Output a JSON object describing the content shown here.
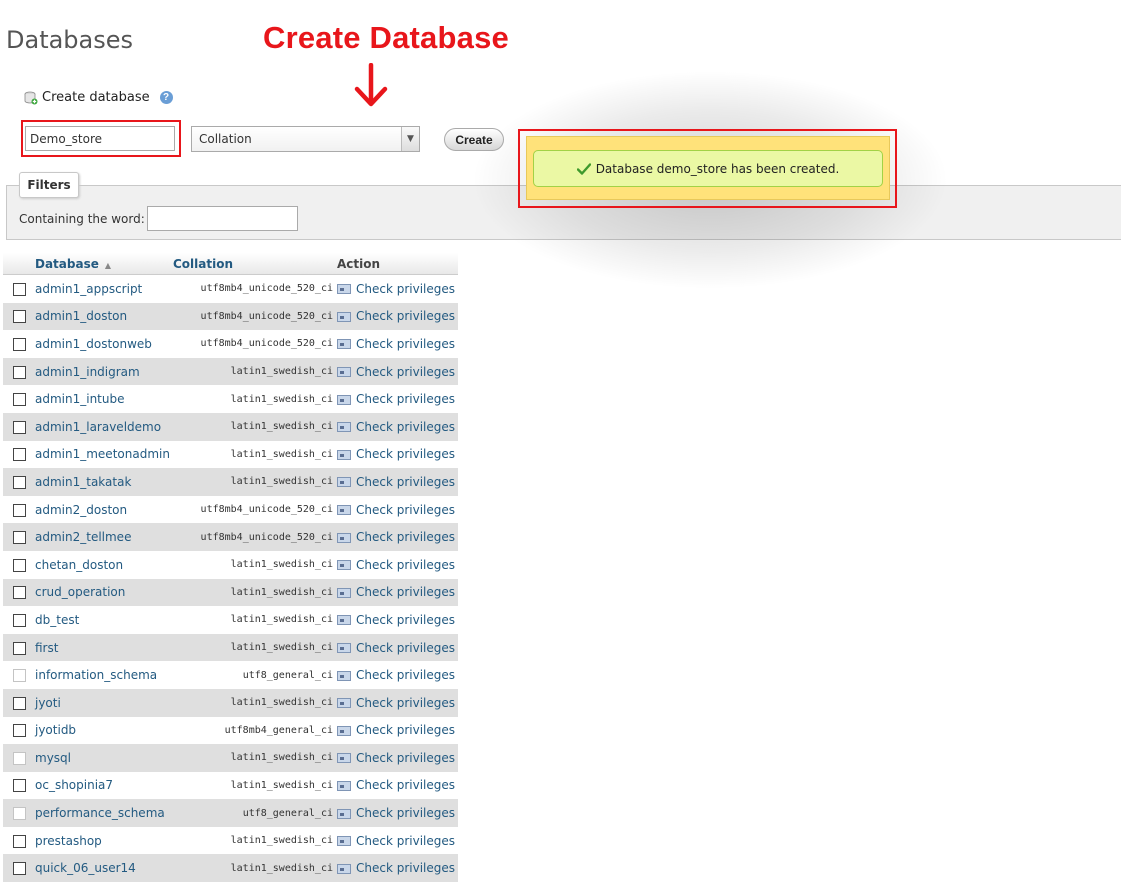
{
  "page_title": "Databases",
  "annotation": "Create Database",
  "create_db": {
    "label": "Create database",
    "name_value": "Demo_store",
    "collation_selected": "Collation",
    "create_button": "Create"
  },
  "notice": {
    "message": "Database demo_store has been created."
  },
  "filters": {
    "tab_label": "Filters",
    "containing_label": "Containing the word:",
    "input_value": ""
  },
  "table": {
    "columns": [
      "Database",
      "Collation",
      "Action"
    ],
    "action_label": "Check privileges",
    "rows": [
      {
        "name": "admin1_appscript",
        "collation": "utf8mb4_unicode_520_ci"
      },
      {
        "name": "admin1_doston",
        "collation": "utf8mb4_unicode_520_ci"
      },
      {
        "name": "admin1_dostonweb",
        "collation": "utf8mb4_unicode_520_ci"
      },
      {
        "name": "admin1_indigram",
        "collation": "latin1_swedish_ci"
      },
      {
        "name": "admin1_intube",
        "collation": "latin1_swedish_ci"
      },
      {
        "name": "admin1_laraveldemo",
        "collation": "latin1_swedish_ci"
      },
      {
        "name": "admin1_meetonadmin",
        "collation": "latin1_swedish_ci"
      },
      {
        "name": "admin1_takatak",
        "collation": "latin1_swedish_ci"
      },
      {
        "name": "admin2_doston",
        "collation": "utf8mb4_unicode_520_ci"
      },
      {
        "name": "admin2_tellmee",
        "collation": "utf8mb4_unicode_520_ci"
      },
      {
        "name": "chetan_doston",
        "collation": "latin1_swedish_ci"
      },
      {
        "name": "crud_operation",
        "collation": "latin1_swedish_ci"
      },
      {
        "name": "db_test",
        "collation": "latin1_swedish_ci"
      },
      {
        "name": "first",
        "collation": "latin1_swedish_ci"
      },
      {
        "name": "information_schema",
        "collation": "utf8_general_ci"
      },
      {
        "name": "jyoti",
        "collation": "latin1_swedish_ci"
      },
      {
        "name": "jyotidb",
        "collation": "utf8mb4_general_ci"
      },
      {
        "name": "mysql",
        "collation": "latin1_swedish_ci"
      },
      {
        "name": "oc_shopinia7",
        "collation": "latin1_swedish_ci"
      },
      {
        "name": "performance_schema",
        "collation": "utf8_general_ci"
      },
      {
        "name": "prestashop",
        "collation": "latin1_swedish_ci"
      },
      {
        "name": "quick_06_user14",
        "collation": "latin1_swedish_ci"
      }
    ]
  }
}
